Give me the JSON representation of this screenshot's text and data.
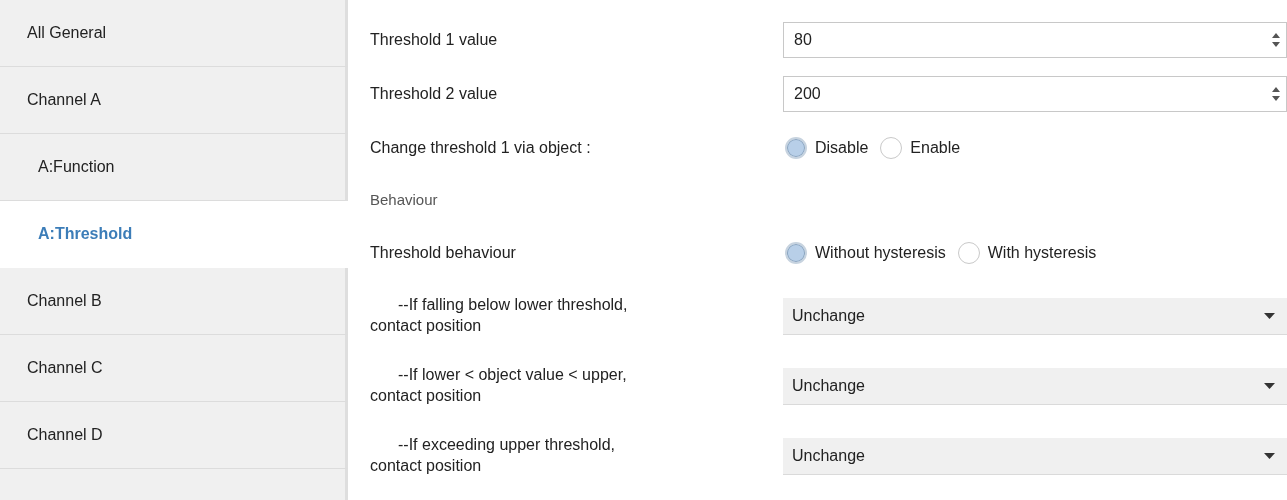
{
  "sidebar": {
    "items": [
      {
        "label": "All General",
        "selected": false
      },
      {
        "label": "Channel A",
        "selected": false,
        "children": [
          {
            "label": "A:Function",
            "selected": false
          },
          {
            "label": "A:Threshold",
            "selected": true
          }
        ]
      },
      {
        "label": "Channel B",
        "selected": false
      },
      {
        "label": "Channel C",
        "selected": false
      },
      {
        "label": "Channel D",
        "selected": false
      }
    ]
  },
  "parameters": [
    {
      "kind": "spin",
      "label": "Threshold 1 value",
      "value": "80"
    },
    {
      "kind": "spin",
      "label": "Threshold 2 value",
      "value": "200"
    },
    {
      "kind": "radio",
      "label": "Change threshold 1 via object :",
      "options": [
        {
          "label": "Disable",
          "selected": true
        },
        {
          "label": "Enable",
          "selected": false
        }
      ]
    },
    {
      "kind": "header",
      "label": "Behaviour"
    },
    {
      "kind": "radio",
      "label": "Threshold behaviour",
      "options": [
        {
          "label": "Without hysteresis",
          "selected": true
        },
        {
          "label": "With hysteresis",
          "selected": false
        }
      ]
    },
    {
      "kind": "dropdown",
      "label": "--If falling below lower threshold, contact position",
      "value": "Unchange"
    },
    {
      "kind": "dropdown",
      "label": "--If lower < object value < upper, contact position",
      "value": "Unchange"
    },
    {
      "kind": "dropdown",
      "label": "--If exceeding upper threshold, contact position",
      "value": "Unchange"
    }
  ]
}
